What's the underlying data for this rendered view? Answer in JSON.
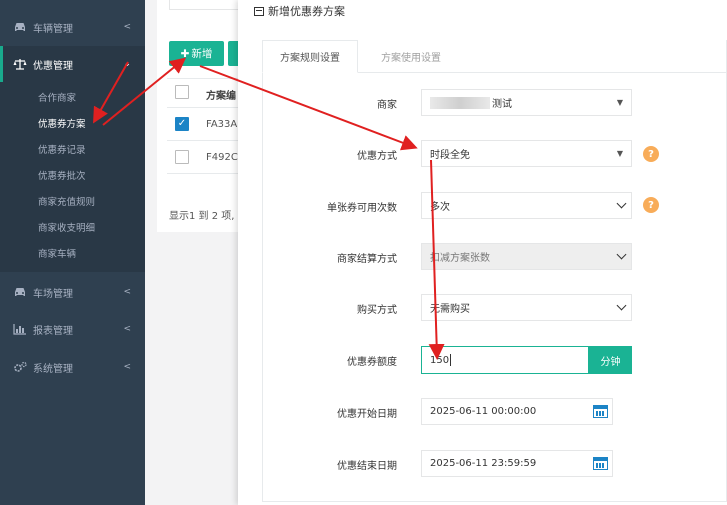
{
  "sidebar": {
    "items": [
      {
        "label": "车辆管理",
        "icon": "car-icon"
      },
      {
        "label": "优惠管理",
        "icon": "balance-scale-icon"
      },
      {
        "label": "车场管理",
        "icon": "car-icon"
      },
      {
        "label": "报表管理",
        "icon": "bar-chart-icon"
      },
      {
        "label": "系统管理",
        "icon": "cogs-icon"
      }
    ],
    "sub_items": [
      "合作商家",
      "优惠券方案",
      "优惠券记录",
      "优惠券批次",
      "商家充值规则",
      "商家收支明细",
      "商家车辆"
    ]
  },
  "list": {
    "add_button": "新增",
    "col_header": "方案编",
    "row1": "FA33A",
    "row2": "F492C",
    "footer": "显示1 到 2 项,"
  },
  "modal": {
    "title": "新增优惠券方案",
    "tabs": [
      "方案规则设置",
      "方案使用设置"
    ],
    "fields": {
      "merchant": {
        "label": "商家",
        "value": "测试"
      },
      "discount_type": {
        "label": "优惠方式",
        "value": "时段全免"
      },
      "usage_count": {
        "label": "单张券可用次数",
        "value": "多次"
      },
      "settlement": {
        "label": "商家结算方式",
        "value": "扣减方案张数"
      },
      "purchase": {
        "label": "购买方式",
        "value": "无需购买"
      },
      "quota": {
        "label": "优惠券额度",
        "value": "150",
        "unit": "分钟"
      },
      "start_date": {
        "label": "优惠开始日期",
        "value": "2025-06-11 00:00:00"
      },
      "end_date": {
        "label": "优惠结束日期",
        "value": "2025-06-11 23:59:59"
      }
    },
    "help_glyph": "?"
  },
  "colors": {
    "sidebar_bg": "#2f4050",
    "accent": "#1ab394",
    "help": "#f8ac59",
    "annotation_arrow": "#e02020"
  }
}
